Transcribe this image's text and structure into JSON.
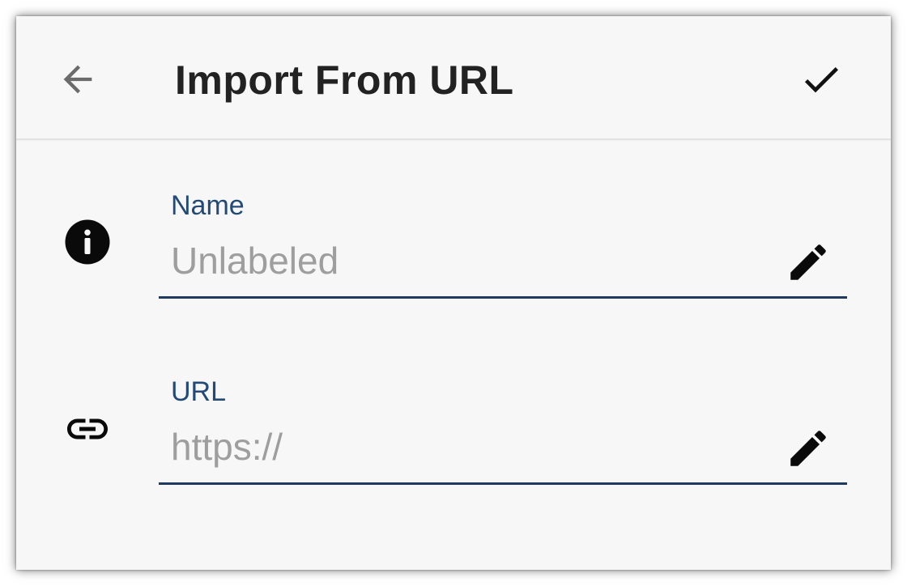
{
  "appbar": {
    "title": "Import From URL",
    "back_icon": "arrow-back-icon",
    "confirm_icon": "check-icon"
  },
  "fields": {
    "name": {
      "label": "Name",
      "placeholder": "Unlabeled",
      "value": "",
      "leading_icon": "info-icon",
      "trailing_icon": "pencil-icon"
    },
    "url": {
      "label": "URL",
      "placeholder": "https://",
      "value": "",
      "leading_icon": "link-icon",
      "trailing_icon": "pencil-icon"
    }
  },
  "colors": {
    "background": "#f7f7f7",
    "label": "#234a77",
    "underline": "#1f3a5e",
    "placeholder": "#9e9e9e",
    "title": "#222222"
  }
}
